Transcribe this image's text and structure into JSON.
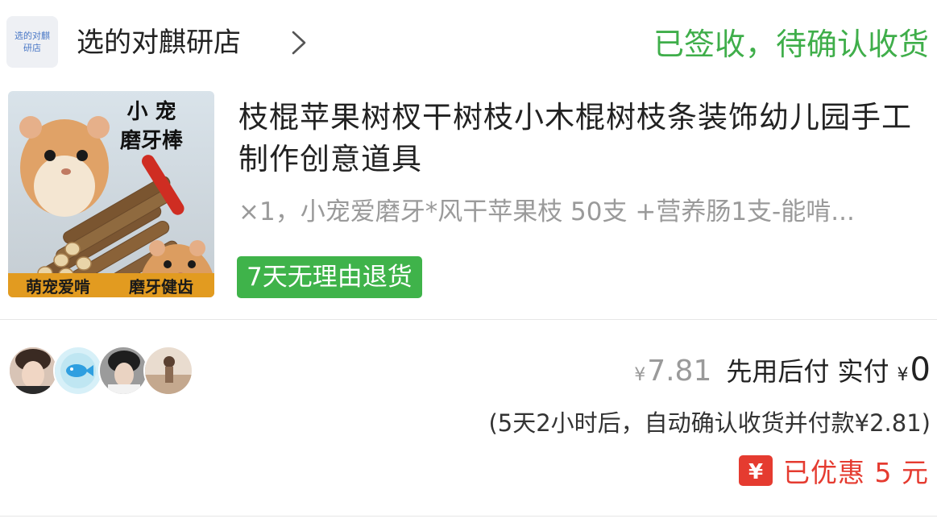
{
  "shop": {
    "logo_text": "选的对麒研店",
    "name": "选的对麒研店",
    "chevron_icon": "chevron-right-icon"
  },
  "order": {
    "status": "已签收，待确认收货"
  },
  "product": {
    "title": "枝棍苹果树杈干树枝小木棍树枝条装饰幼儿园手工制作创意道具",
    "sku": "×1，小宠爱磨牙*风干苹果枝 50支 +营养肠1支-能啃...",
    "return_badge": "7天无理由退货",
    "image": {
      "title_line1": "小 宠",
      "title_line2": "磨牙棒",
      "banner_left": "萌宠爱啃",
      "banner_right": "磨牙健齿"
    }
  },
  "avatars": [
    {
      "name": "avatar-1"
    },
    {
      "name": "avatar-2"
    },
    {
      "name": "avatar-3"
    },
    {
      "name": "avatar-4"
    }
  ],
  "pricing": {
    "currency": "¥",
    "original_price": "7.81",
    "pay_later_label": "先用后付 实付",
    "paid_amount": "0",
    "auto_confirm_note": "(5天2小时后，自动确认收货并付款¥2.81)",
    "discount_icon": "yen-coupon-icon",
    "discount_text": "已优惠 5 元"
  },
  "colors": {
    "status_green": "#3fae4a",
    "badge_green": "#3fb34a",
    "discount_red": "#e53b30"
  }
}
